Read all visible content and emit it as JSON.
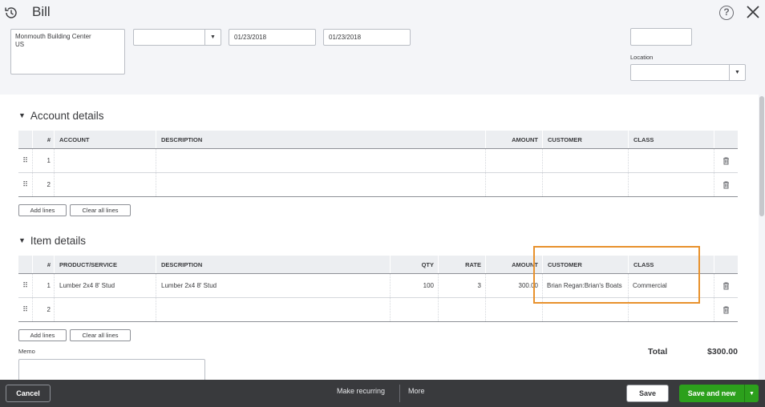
{
  "header": {
    "title": "Bill",
    "help_icon": "?",
    "vendor_address": "Monmouth Building Center\nUS",
    "terms_value": "",
    "bill_date": "01/23/2018",
    "due_date": "01/23/2018",
    "bill_no_value": "",
    "location_label": "Location",
    "location_value": ""
  },
  "account_details": {
    "title": "Account details",
    "columns": [
      "#",
      "ACCOUNT",
      "DESCRIPTION",
      "AMOUNT",
      "CUSTOMER",
      "CLASS"
    ],
    "rows": [
      {
        "num": "1",
        "account": "",
        "description": "",
        "amount": "",
        "customer": "",
        "class": ""
      },
      {
        "num": "2",
        "account": "",
        "description": "",
        "amount": "",
        "customer": "",
        "class": ""
      }
    ],
    "add_lines": "Add lines",
    "clear_lines": "Clear all lines"
  },
  "item_details": {
    "title": "Item details",
    "columns": [
      "#",
      "PRODUCT/SERVICE",
      "DESCRIPTION",
      "QTY",
      "RATE",
      "AMOUNT",
      "CUSTOMER",
      "CLASS"
    ],
    "rows": [
      {
        "num": "1",
        "product": "Lumber 2x4 8' Stud",
        "description": "Lumber 2x4 8' Stud",
        "qty": "100",
        "rate": "3",
        "amount": "300.00",
        "customer": "Brian Regan:Brian's Boats",
        "class": "Commercial"
      },
      {
        "num": "2",
        "product": "",
        "description": "",
        "qty": "",
        "rate": "",
        "amount": "",
        "customer": "",
        "class": ""
      }
    ],
    "add_lines": "Add lines",
    "clear_lines": "Clear all lines"
  },
  "memo_label": "Memo",
  "memo_value": "",
  "total": {
    "label": "Total",
    "value": "$300.00"
  },
  "footer": {
    "cancel": "Cancel",
    "make_recurring": "Make recurring",
    "more": "More",
    "save": "Save",
    "save_and_new": "Save and new"
  },
  "colors": {
    "highlight": "#e8912c",
    "primary_green": "#2ca01c",
    "footer_bg": "#393a3d"
  }
}
